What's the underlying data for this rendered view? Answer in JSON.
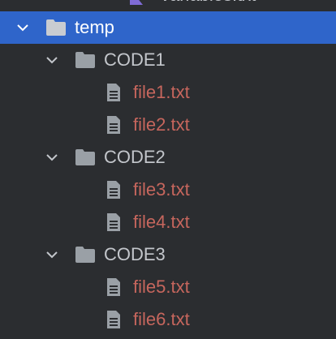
{
  "tree": {
    "partial_top_item": {
      "label": "variables.txt",
      "icon": "kotlin-file-icon"
    },
    "root": {
      "label": "temp",
      "expanded": true,
      "selected": true,
      "children": [
        {
          "label": "CODE1",
          "expanded": true,
          "files": [
            {
              "label": "file1.txt",
              "icon": "text-file-icon"
            },
            {
              "label": "file2.txt",
              "icon": "text-file-icon"
            }
          ]
        },
        {
          "label": "CODE2",
          "expanded": true,
          "files": [
            {
              "label": "file3.txt",
              "icon": "text-file-icon"
            },
            {
              "label": "file4.txt",
              "icon": "text-file-icon"
            }
          ]
        },
        {
          "label": "CODE3",
          "expanded": true,
          "files": [
            {
              "label": "file5.txt",
              "icon": "text-file-icon"
            },
            {
              "label": "file6.txt",
              "icon": "text-file-icon"
            }
          ]
        }
      ]
    },
    "colors": {
      "background": "#2b2d30",
      "selection": "#2f65ca",
      "folder_text": "#c3c6cb",
      "file_text_modified": "#c6665d",
      "icon": "#9aa0a6"
    }
  }
}
